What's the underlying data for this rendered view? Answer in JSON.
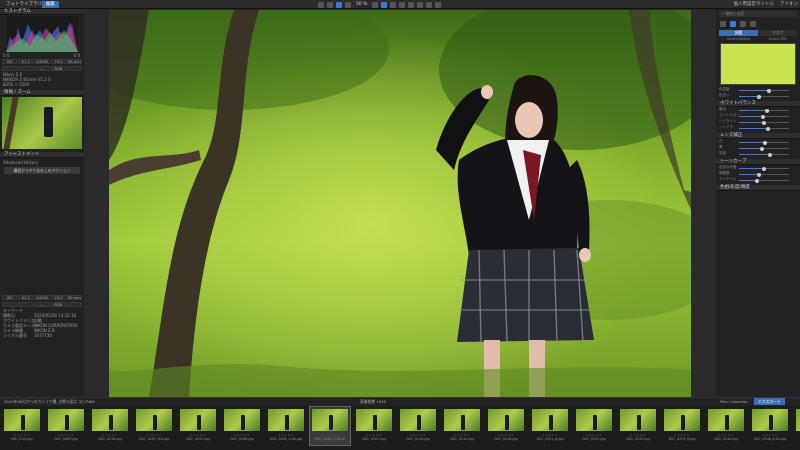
{
  "titlebar": {
    "tab_library": "フォトライブラリ",
    "tab_edit": "編集",
    "zoom": "50 %",
    "right_items": [
      "個人用設定タイトル",
      "アドオン"
    ]
  },
  "left_panel": {
    "histogram": {
      "title": "ヒストグラム",
      "values": [
        "0 0",
        "0 0"
      ]
    },
    "exif_row1": [
      "ISO 100",
      "f/1.2",
      "1/4000 s",
      "+0.0 EV",
      "85 mm"
    ],
    "exif_row2": [
      "",
      "",
      "—",
      "RGB",
      ""
    ],
    "camera_model": "Nikon Z 8",
    "lens": "NIKKOR Z 85mm f/1.2 S",
    "size": "8256 × 5504",
    "nav_title": "情報 / ズーム",
    "adjust_title": "アジャストメント",
    "history_label": "Advanced History",
    "history_button": "最初からやりなおしのアクション",
    "bottom_exif1": [
      "ISO 100",
      "f/1.2",
      "1/4000 s",
      "+0.0 EV",
      "85 mm"
    ],
    "bottom_exif2": [
      "",
      "",
      "—",
      "RGB",
      ""
    ],
    "info_rows": [
      {
        "k": "キーワード",
        "v": ""
      },
      {
        "k": "撮影日",
        "v": "2024/05/26 14:32:16"
      },
      {
        "k": "ホワイトバランス",
        "v": "自動"
      },
      {
        "k": "カメラ製造メーカー",
        "v": "NIKON CORPORATION"
      },
      {
        "k": "カメラ機種",
        "v": "NIKON Z 8"
      },
      {
        "k": "シリアル番号",
        "v": "3077730"
      }
    ]
  },
  "right_panel": {
    "search_placeholder": "機能を検索",
    "tabs": [
      "調整",
      "マスク"
    ],
    "sub_tabs": [
      "SmartLighting",
      "Smart HDR"
    ],
    "sections": [
      {
        "title": "ホワイトバランス"
      },
      {
        "title": "レンズ補正"
      },
      {
        "title": "トーンカーブ"
      },
      {
        "title": "色相/彩度/輝度"
      }
    ],
    "sliders": [
      {
        "label": "色温度",
        "value": 60
      },
      {
        "label": "色合い",
        "value": 40
      },
      {
        "label": "露出",
        "value": 55
      },
      {
        "label": "コントラスト",
        "value": 48
      },
      {
        "label": "ハイライト",
        "value": 50
      },
      {
        "label": "シャドウ",
        "value": 58
      },
      {
        "label": "白",
        "value": 52
      },
      {
        "label": "黒",
        "value": 45
      },
      {
        "label": "彩度",
        "value": 62
      },
      {
        "label": "自然な彩度",
        "value": 50
      },
      {
        "label": "明瞭度",
        "value": 40
      },
      {
        "label": "ディテール",
        "value": 36
      }
    ],
    "preview_color": "#c9e44e"
  },
  "filmstrip": {
    "header_left": "2024年06月からのカメラで撮_白鷺公園エコロ RAW",
    "header_center": "画像枚数 1955",
    "header_right": [
      "Film Collection",
      "エクスポート"
    ],
    "thumbs": [
      {
        "name": "IMG_6.00.jpg",
        "selected": false
      },
      {
        "name": "DSC_0467.jpg",
        "selected": false
      },
      {
        "name": "DSC_0476.jpg",
        "selected": false
      },
      {
        "name": "DSC_0491_6.0.jpg",
        "selected": false
      },
      {
        "name": "DSC_0497.jpg",
        "selected": false
      },
      {
        "name": "DSC_0498.jpg",
        "selected": false
      },
      {
        "name": "DSC_0502_6.00.jpg",
        "selected": false
      },
      {
        "name": "DSC_0504_2.00.tif",
        "selected": true
      },
      {
        "name": "DSC_0507.jpg",
        "selected": false
      },
      {
        "name": "DSC_0510.jpg",
        "selected": false
      },
      {
        "name": "DSC_0514.jpg",
        "selected": false
      },
      {
        "name": "DSC_0518.jpg",
        "selected": false
      },
      {
        "name": "DSC_0521_6.jpg",
        "selected": false
      },
      {
        "name": "DSC_0525.jpg",
        "selected": false
      },
      {
        "name": "DSC_0529.jpg",
        "selected": false
      },
      {
        "name": "DSC_0533_6.jpg",
        "selected": false
      },
      {
        "name": "DSC_0540.jpg",
        "selected": false
      },
      {
        "name": "DSC_0546_6.00.jpg",
        "selected": false
      },
      {
        "name": "DSC_0551.jpg",
        "selected": false
      }
    ]
  }
}
